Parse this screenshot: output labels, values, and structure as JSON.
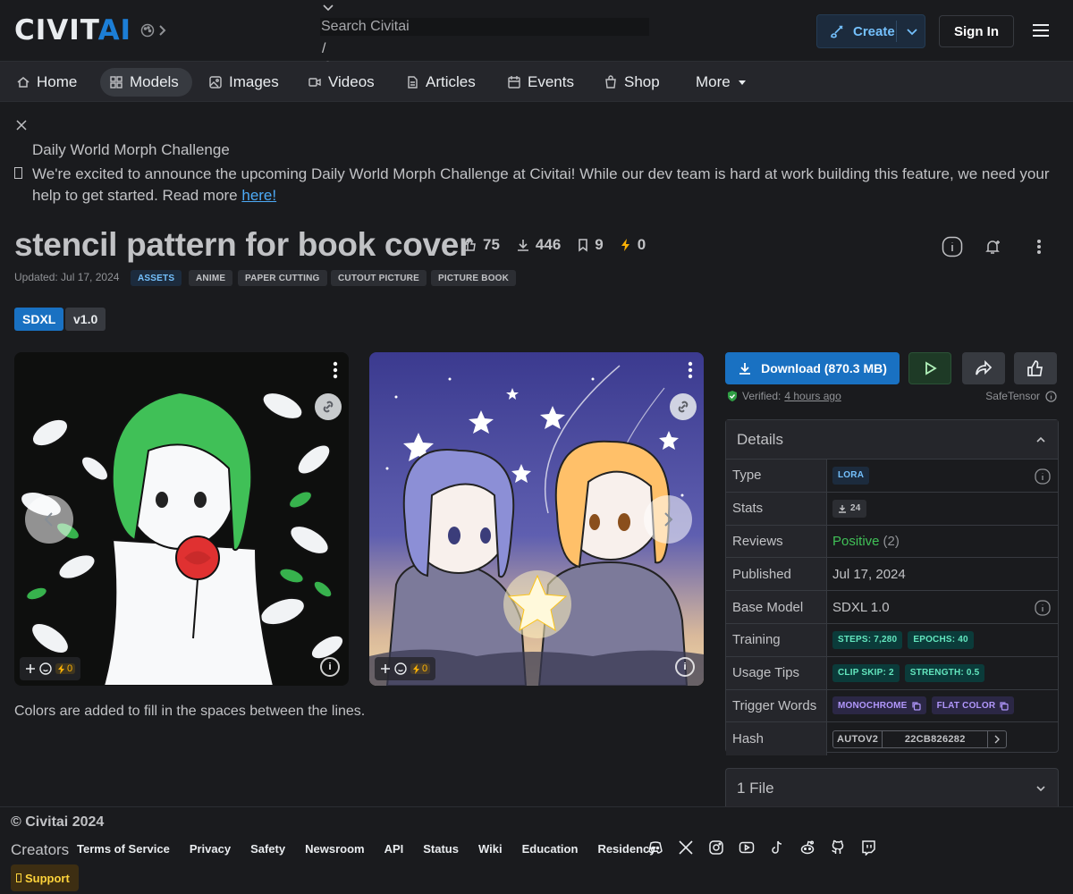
{
  "header": {
    "logo_main": "CIVIT",
    "logo_accent": "AI",
    "search_placeholder": "Search Civitai",
    "search_slash": "/",
    "create_label": "Create",
    "signin_label": "Sign In"
  },
  "nav": [
    {
      "label": "Home",
      "icon": "home-icon"
    },
    {
      "label": "Models",
      "icon": "grid-icon",
      "active": true
    },
    {
      "label": "Images",
      "icon": "photo-icon"
    },
    {
      "label": "Videos",
      "icon": "video-icon"
    },
    {
      "label": "Articles",
      "icon": "article-icon"
    },
    {
      "label": "Events",
      "icon": "calendar-icon"
    },
    {
      "label": "Shop",
      "icon": "shop-icon"
    },
    {
      "label": "More",
      "icon": "caret-down-icon"
    }
  ],
  "announcement": {
    "title": "Daily World Morph Challenge",
    "body": "We're excited to announce the upcoming Daily World Morph Challenge at Civitai! While our dev team is hard at work building this feature, we need your help to get started. Read more ",
    "link_text": "here!"
  },
  "model": {
    "title": "stencil pattern for book cover",
    "stats": {
      "likes": "75",
      "downloads": "446",
      "collected": "9",
      "buzz": "0"
    },
    "updated": "Updated: Jul 17, 2024",
    "tags": [
      "ASSETS",
      "ANIME",
      "PAPER CUTTING",
      "CUTOUT PICTURE",
      "PICTURE BOOK"
    ],
    "base_badge": "SDXL",
    "version_badge": "v1.0",
    "description": "Colors are added to fill in the spaces between the lines."
  },
  "images": [
    {
      "buzz": "0"
    },
    {
      "buzz": "0"
    }
  ],
  "download": {
    "label": "Download (870.3 MB)",
    "verified_prefix": "Verified:",
    "verified_time": "4 hours ago",
    "format": "SafeTensor"
  },
  "details": {
    "heading": "Details",
    "type_label": "Type",
    "type_value": "LORA",
    "stats_label": "Stats",
    "stats_value": "24",
    "reviews_label": "Reviews",
    "reviews_value": "Positive",
    "reviews_count": "(2)",
    "published_label": "Published",
    "published_value": "Jul 17, 2024",
    "base_label": "Base Model",
    "base_value": "SDXL 1.0",
    "training_label": "Training",
    "training_steps": "STEPS: 7,280",
    "training_epochs": "EPOCHS: 40",
    "usage_label": "Usage Tips",
    "usage_clip": "CLIP SKIP: 2",
    "usage_strength": "STRENGTH: 0.5",
    "trigger_label": "Trigger Words",
    "trigger_1": "MONOCHROME",
    "trigger_2": "FLAT COLOR",
    "hash_label": "Hash",
    "hash_type": "AUTOV2",
    "hash_value": "22CB826282"
  },
  "files": {
    "label": "1 File"
  },
  "footer": {
    "copyright": "© Civitai 2024",
    "creators": "Creators",
    "links": [
      "Terms of Service",
      "Privacy",
      "Safety",
      "Newsroom",
      "API",
      "Status",
      "Wiki",
      "Education",
      "Residency"
    ],
    "support": "Support",
    "socials": [
      "discord-icon",
      "x-icon",
      "instagram-icon",
      "youtube-icon",
      "tiktok-icon",
      "reddit-icon",
      "github-icon",
      "twitch-icon"
    ]
  },
  "colors": {
    "background": "#1a1b1e",
    "accent": "#1971c2",
    "positive": "#40c057",
    "buzz": "#fab005"
  }
}
